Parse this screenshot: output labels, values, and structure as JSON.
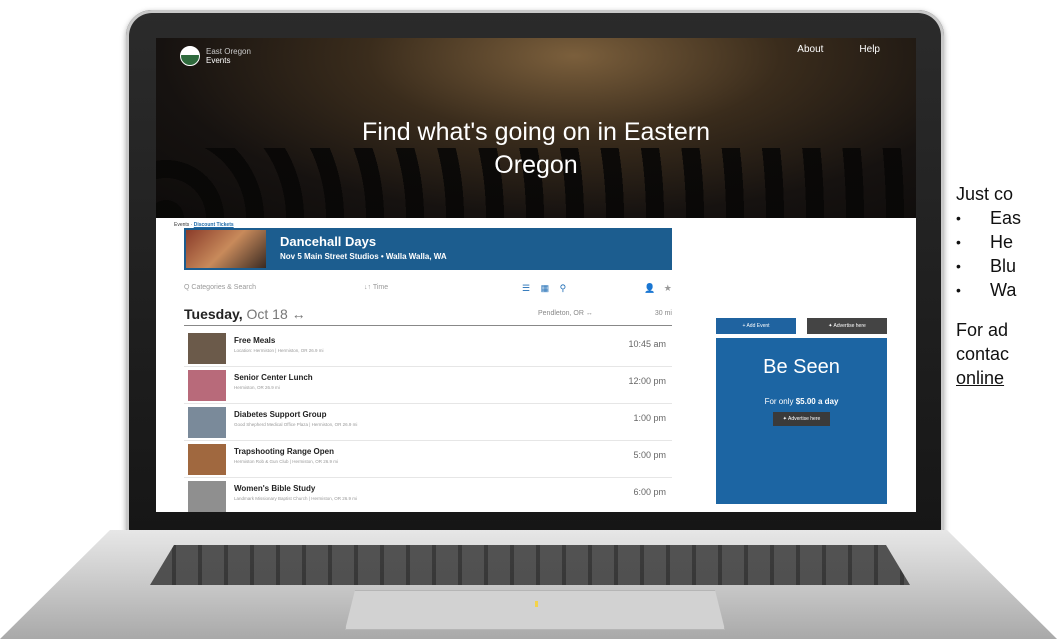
{
  "site": {
    "logo_line1": "East Oregon",
    "logo_line2": "Events",
    "nav": [
      "About",
      "Help"
    ],
    "hero_line1": "Find what's going on in Eastern",
    "hero_line2": "Oregon"
  },
  "breadcrumb": {
    "prefix": "Events ·",
    "link": "Discount Tickets"
  },
  "featured": {
    "title": "Dancehall Days",
    "subtitle": "Nov 5   Main Street Studios   •  Walla Walla, WA"
  },
  "toolbar": {
    "search": "Q Categories & Search",
    "time": "↓↑ Time",
    "views": "☰ ▦ ⚲",
    "person": "👤",
    "star": "★"
  },
  "date_header": {
    "day": "Tuesday,",
    "date": "Oct 18 ↔",
    "location": "Pendleton, OR ↔",
    "distance": "30 mi"
  },
  "events": [
    {
      "name": "Free Meals",
      "location": "Location: Hermiston | Hermiston, OR   26.9 mi",
      "time": "10:45 am",
      "thumb_color": "#6b5a4a"
    },
    {
      "name": "Senior Center Lunch",
      "location": "Hermiston, OR   26.9 mi",
      "time": "12:00 pm",
      "thumb_color": "#b86a7a"
    },
    {
      "name": "Diabetes Support Group",
      "location": "Good Shepherd Medical Office Plaza | Hermiston, OR   26.9 mi",
      "time": "1:00 pm",
      "thumb_color": "#7a8a9a"
    },
    {
      "name": "Trapshooting Range Open",
      "location": "Hermiston Rob & Gun Club | Hermiston, OR   26.9 mi",
      "time": "5:00 pm",
      "thumb_color": "#a0683f"
    },
    {
      "name": "Women's Bible Study",
      "location": "Landmark Missionary Baptist Church | Hermiston, OR   26.9 mi",
      "time": "6:00 pm",
      "thumb_color": "#8f8f8f"
    }
  ],
  "side_buttons": {
    "add_event": "+ Add Event",
    "advertise": "✦ Advertise here"
  },
  "promo": {
    "title": "Be Seen",
    "sub_prefix": "For only",
    "price": "$5.00 a day",
    "button": "✦ Advertise here"
  },
  "side_text": {
    "intro": "Just co",
    "items": [
      "Eas",
      "He",
      "Blu",
      "Wa"
    ],
    "contact1": "For ad",
    "contact2": "contac",
    "email": "online"
  }
}
